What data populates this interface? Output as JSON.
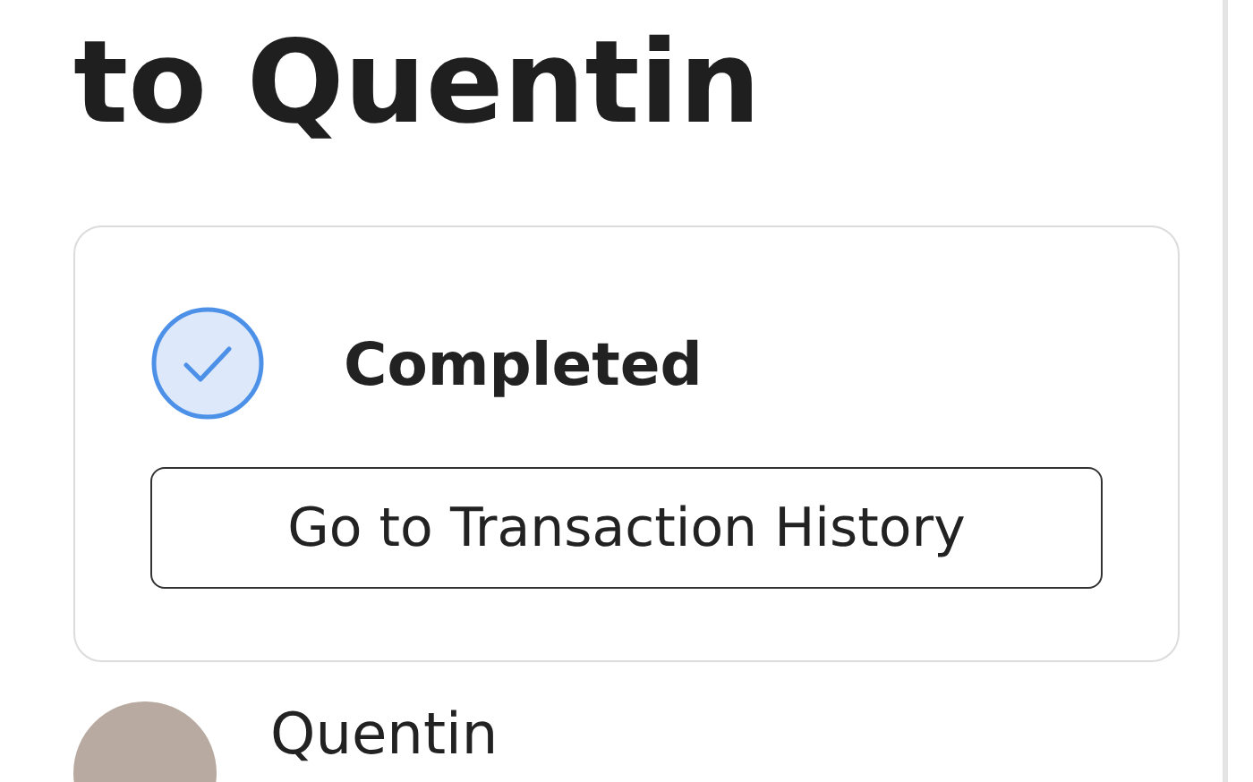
{
  "title": "to Quentin",
  "status": {
    "label": "Completed",
    "completed": true
  },
  "history_button": "Go to Transaction History",
  "recipient": {
    "name": "Quentin"
  }
}
